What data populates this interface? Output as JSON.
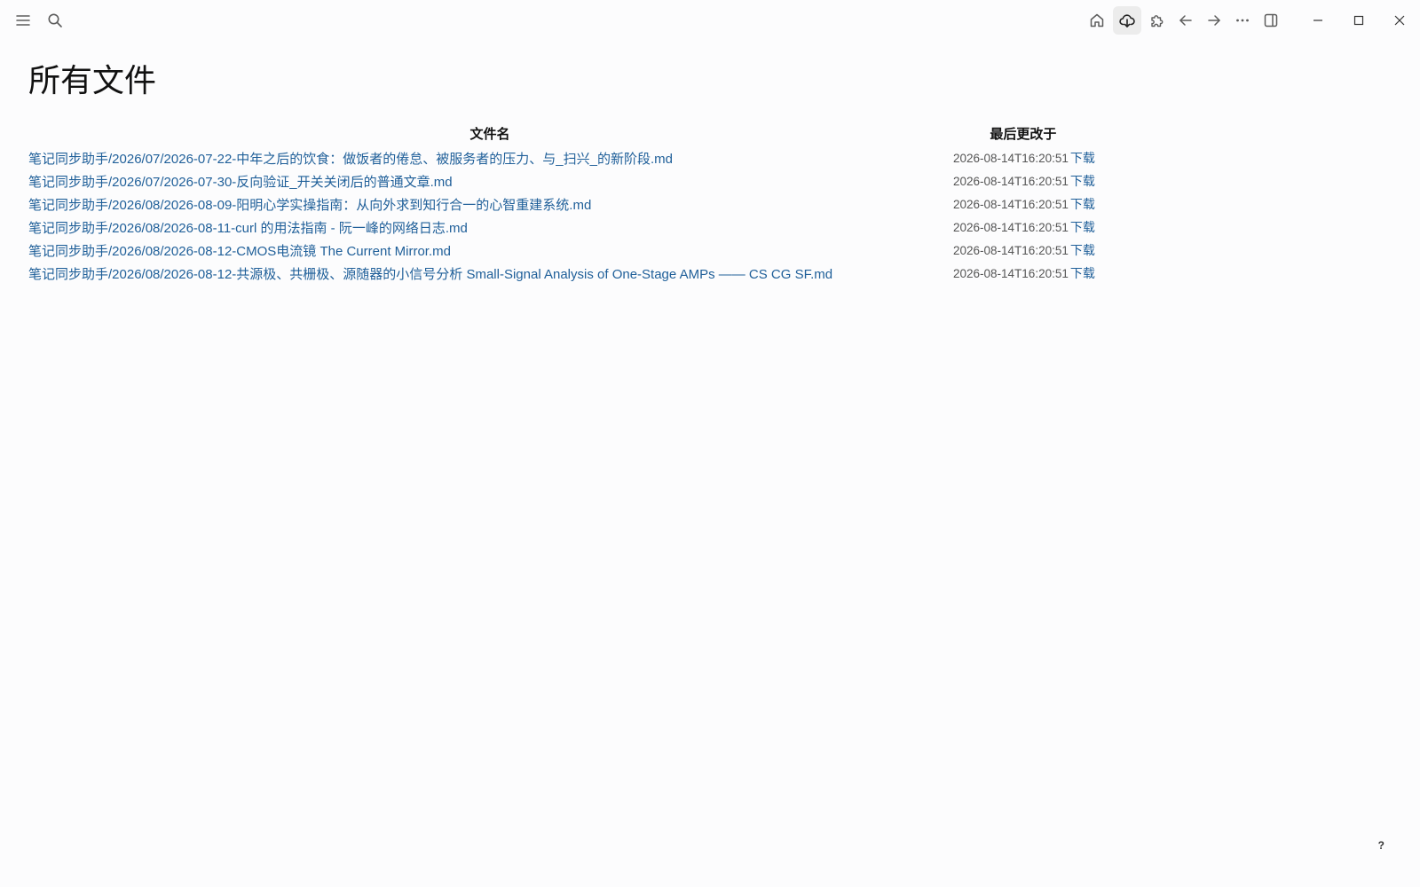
{
  "titlebar": {
    "left_icons": [
      "menu-icon",
      "search-icon"
    ],
    "right_icons": [
      "home-icon",
      "cloud-download-icon",
      "puzzle-icon",
      "arrow-left-icon",
      "arrow-right-icon",
      "more-icon",
      "sidebar-toggle-icon"
    ],
    "window_controls": [
      "minimize-icon",
      "maximize-icon",
      "close-icon"
    ]
  },
  "page": {
    "title": "所有文件",
    "columns": {
      "name": "文件名",
      "modified": "最后更改于"
    },
    "files": [
      {
        "name": "笔记同步助手/2026/07/2026-07-22-中年之后的饮食：做饭者的倦怠、被服务者的压力、与_扫兴_的新阶段.md",
        "modified": "2026-08-14T16:20:51",
        "download": "下载"
      },
      {
        "name": "笔记同步助手/2026/07/2026-07-30-反向验证_开关关闭后的普通文章.md",
        "modified": "2026-08-14T16:20:51",
        "download": "下载"
      },
      {
        "name": "笔记同步助手/2026/08/2026-08-09-阳明心学实操指南：从向外求到知行合一的心智重建系统.md",
        "modified": "2026-08-14T16:20:51",
        "download": "下载"
      },
      {
        "name": "笔记同步助手/2026/08/2026-08-11-curl 的用法指南 - 阮一峰的网络日志.md",
        "modified": "2026-08-14T16:20:51",
        "download": "下载"
      },
      {
        "name": "笔记同步助手/2026/08/2026-08-12-CMOS电流镜 The Current Mirror.md",
        "modified": "2026-08-14T16:20:51",
        "download": "下载"
      },
      {
        "name": "笔记同步助手/2026/08/2026-08-12-共源极、共栅极、源随器的小信号分析 Small-Signal Analysis of One-Stage AMPs —— CS CG SF.md",
        "modified": "2026-08-14T16:20:51",
        "download": "下载"
      }
    ]
  },
  "help": "?",
  "colors": {
    "link": "#1f5f99",
    "background": "#fcfcfd"
  }
}
